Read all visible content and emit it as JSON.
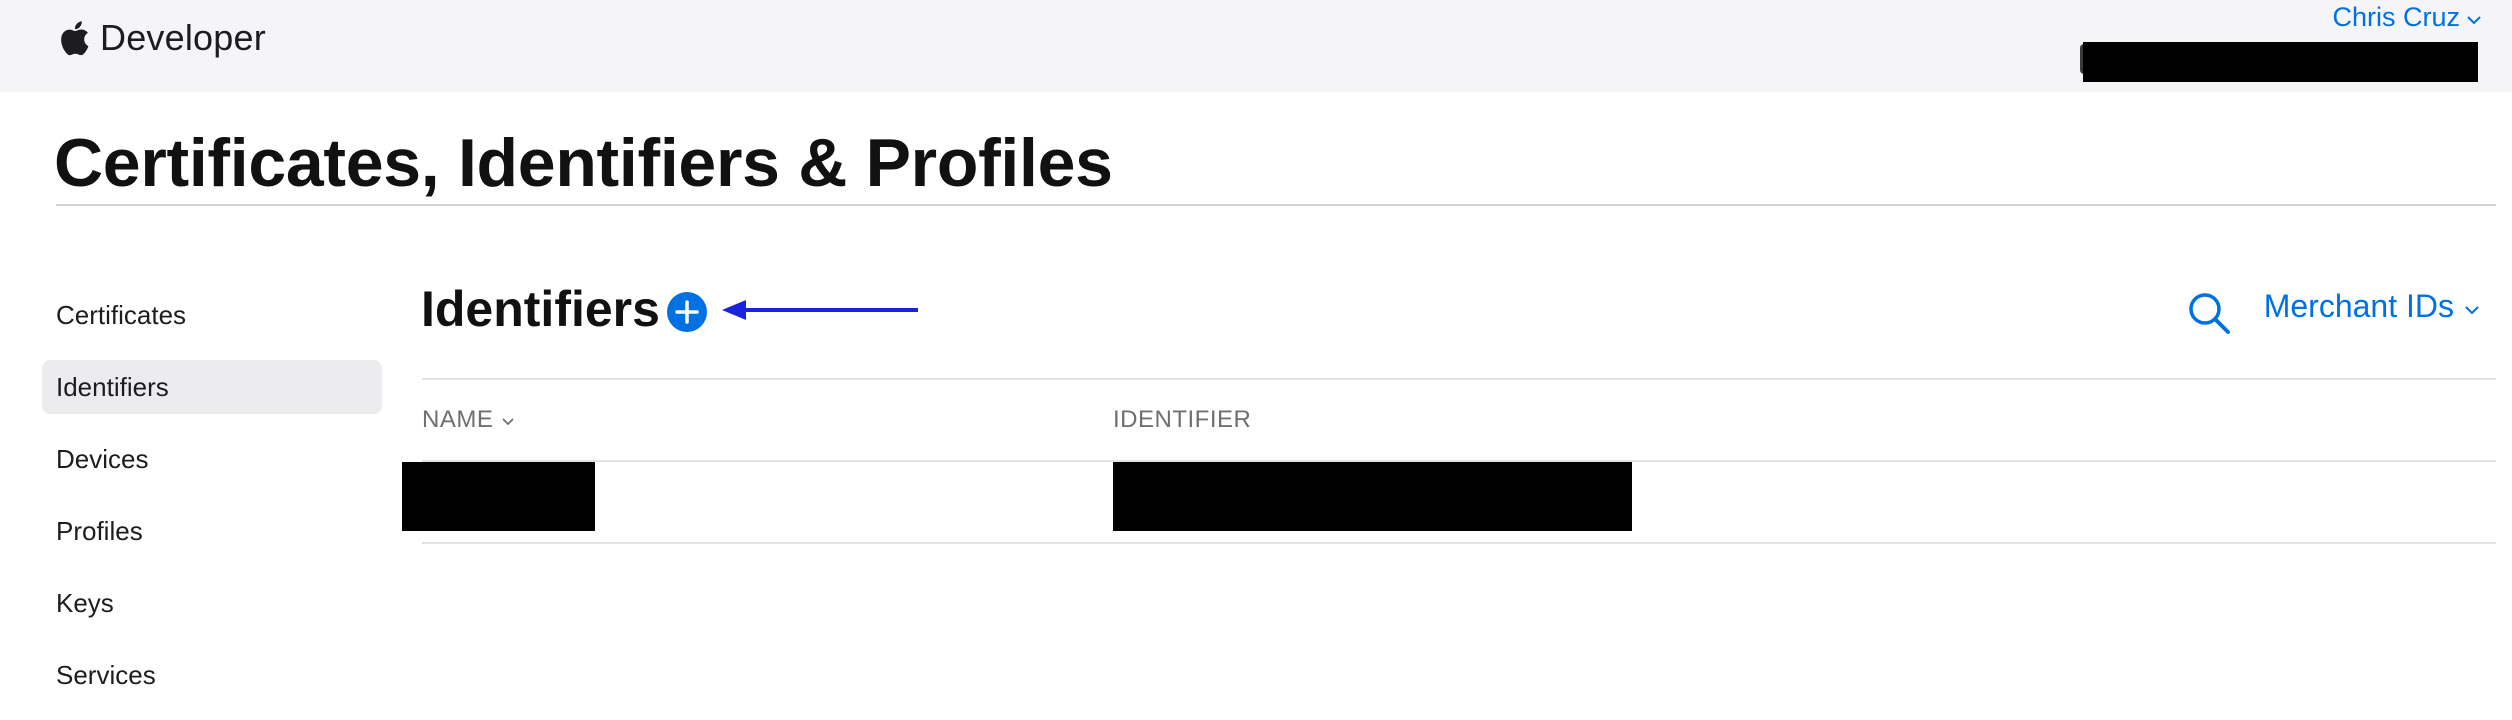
{
  "header": {
    "brand": "Developer",
    "account_name": "Chris Cruz"
  },
  "page": {
    "title": "Certificates, Identifiers & Profiles"
  },
  "sidebar": {
    "items": [
      {
        "label": "Certificates",
        "active": false
      },
      {
        "label": "Identifiers",
        "active": true
      },
      {
        "label": "Devices",
        "active": false
      },
      {
        "label": "Profiles",
        "active": false
      },
      {
        "label": "Keys",
        "active": false
      },
      {
        "label": "Services",
        "active": false
      }
    ]
  },
  "main": {
    "section_title": "Identifiers",
    "filter_label": "Merchant IDs",
    "table": {
      "columns": [
        "NAME",
        "IDENTIFIER"
      ],
      "rows": 1
    }
  },
  "colors": {
    "accent": "#0071e3",
    "annotation_arrow": "#1a22e0",
    "topbar_bg": "#f5f5f7",
    "active_item_bg": "#ececee"
  },
  "icons": {
    "brand": "apple-logo-icon",
    "add": "plus-circle-icon",
    "search": "search-icon",
    "dropdown": "chevron-down-icon"
  }
}
